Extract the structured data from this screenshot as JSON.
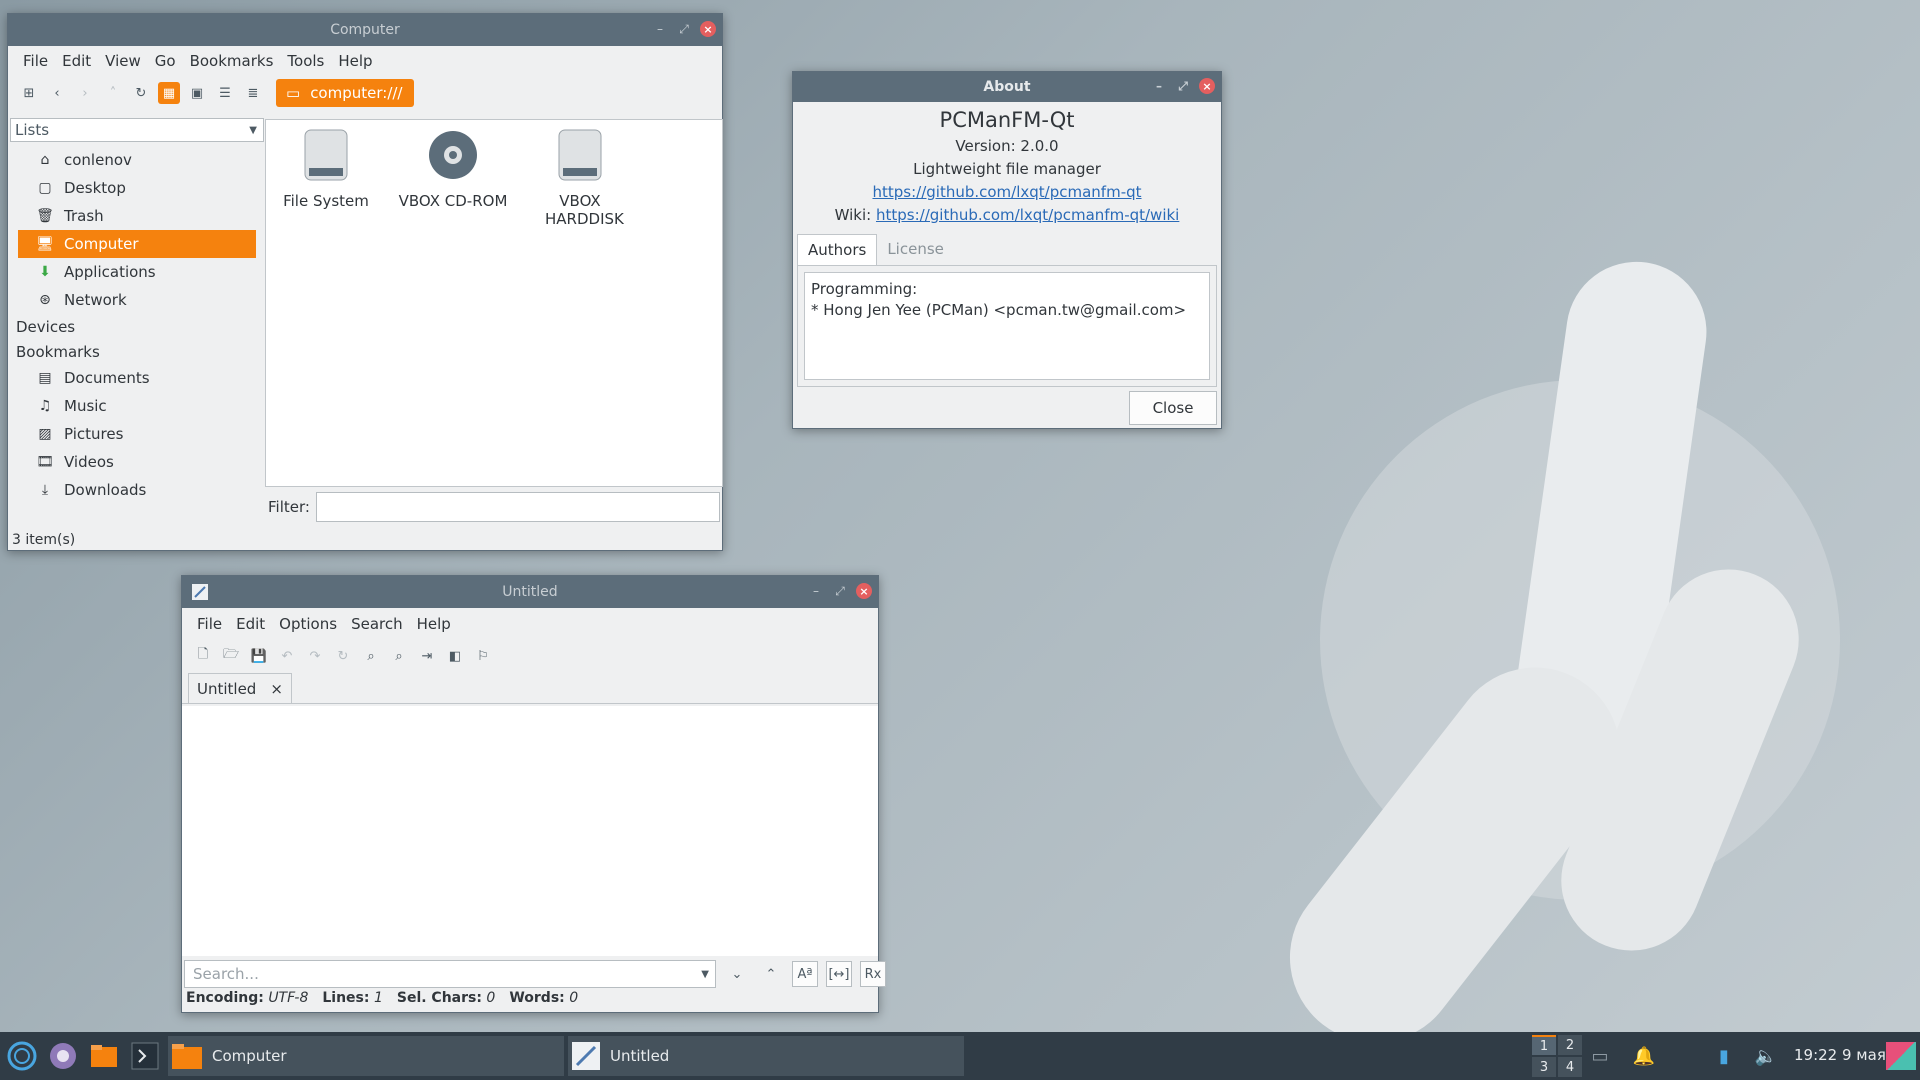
{
  "file_manager": {
    "title": "Computer",
    "menu": [
      "File",
      "Edit",
      "View",
      "Go",
      "Bookmarks",
      "Tools",
      "Help"
    ],
    "path": "computer:///",
    "side_select": "Lists",
    "places": [
      "conlenov",
      "Desktop",
      "Trash",
      "Computer",
      "Applications",
      "Network"
    ],
    "devices_header": "Devices",
    "bookmarks_header": "Bookmarks",
    "bookmarks": [
      "Documents",
      "Music",
      "Pictures",
      "Videos",
      "Downloads"
    ],
    "files": [
      {
        "name": "File System",
        "icon": "harddisk-icon"
      },
      {
        "name": "VBOX CD-ROM",
        "icon": "cdrom-icon"
      },
      {
        "name": "VBOX HARDDISK",
        "icon": "harddisk-icon"
      }
    ],
    "filter_label": "Filter:",
    "status": "3 item(s)"
  },
  "about": {
    "title": "About",
    "app_name": "PCManFM-Qt",
    "version": "Version: 2.0.0",
    "description": "Lightweight file manager",
    "homepage": "https://github.com/lxqt/pcmanfm-qt",
    "wiki_label": "Wiki:",
    "wiki": "https://github.com/lxqt/pcmanfm-qt/wiki",
    "tabs": [
      "Authors",
      "License"
    ],
    "programming_label": "Programming:",
    "author": "* Hong Jen Yee (PCMan) <pcman.tw@gmail.com>",
    "close_label": "Close"
  },
  "editor": {
    "title": "Untitled",
    "menu": [
      "File",
      "Edit",
      "Options",
      "Search",
      "Help"
    ],
    "tab_label": "Untitled",
    "tab_close": "×",
    "search_placeholder": "Search...",
    "status": {
      "encoding_label": "Encoding:",
      "encoding": "UTF-8",
      "lines_label": "Lines:",
      "lines": "1",
      "sel_label": "Sel. Chars:",
      "sel": "0",
      "words_label": "Words:",
      "words": "0"
    }
  },
  "taskbar": {
    "tasks": [
      "Computer",
      "Untitled"
    ],
    "desktops": [
      "1",
      "2",
      "3",
      "4"
    ],
    "clock": "19:22 9 мая"
  }
}
